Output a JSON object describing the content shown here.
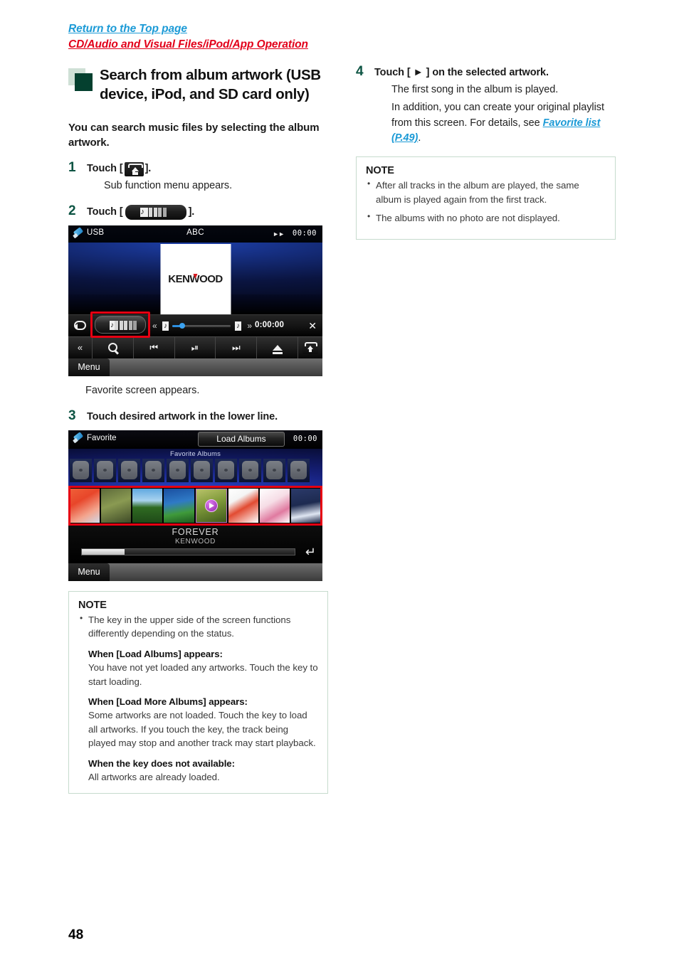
{
  "header": {
    "top_link": "Return to the Top page",
    "sub_link": "CD/Audio and Visual Files/iPod/App Operation"
  },
  "chapter": {
    "title": "Search from album artwork (USB device, iPod, and SD card only)",
    "lead": "You can search music files by selecting the album artwork."
  },
  "steps": {
    "s1": {
      "num": "1",
      "head_pre": "Touch [",
      "head_post": "].",
      "body": "Sub function menu appears."
    },
    "s2": {
      "num": "2",
      "head_pre": "Touch [",
      "head_post": "].",
      "body": "Favorite screen appears."
    },
    "s3": {
      "num": "3",
      "head": "Touch desired artwork in the lower line."
    },
    "s4": {
      "num": "4",
      "head": "Touch [ ► ] on the selected artwork.",
      "body1": "The first song in the album is played.",
      "body2_pre": "In addition, you can create your original playlist from this screen. For details, see ",
      "body2_link": "Favorite list (P.49)",
      "body2_post": "."
    }
  },
  "device_usb": {
    "source_label": "USB",
    "title": "ABC",
    "clock": "00:00",
    "artwork_logo": "KENWOOD",
    "elapsed_time": "0:00:00",
    "menu_label": "Menu"
  },
  "device_favorite": {
    "source_label": "Favorite",
    "load_button": "Load Albums",
    "clock": "00:00",
    "upper_caption": "Favorite Albums",
    "upper_placeholder_count": 10,
    "album_title": "FOREVER",
    "album_artist": "KENWOOD",
    "menu_label": "Menu",
    "thumbnails": [
      {
        "id": "album-1",
        "playing": false
      },
      {
        "id": "album-2",
        "playing": false
      },
      {
        "id": "album-3",
        "playing": false
      },
      {
        "id": "album-4",
        "playing": false
      },
      {
        "id": "album-5",
        "playing": true
      },
      {
        "id": "album-6",
        "playing": false
      },
      {
        "id": "album-7",
        "playing": false
      },
      {
        "id": "album-8",
        "playing": false
      }
    ]
  },
  "note_left": {
    "title": "NOTE",
    "bullet1": "The key in the upper side of the screen functions differently depending on the status.",
    "sub1_head": "When [Load Albums] appears:",
    "sub1_body": "You have not yet loaded any artworks. Touch the key to start loading.",
    "sub2_head": "When [Load More Albums] appears:",
    "sub2_body": "Some artworks are not loaded. Touch the key to load all artworks. If you touch the key, the track being played may stop and another track may start playback.",
    "sub3_head": "When the key does not available:",
    "sub3_body": "All artworks are already loaded."
  },
  "note_right": {
    "title": "NOTE",
    "bullet1": "After all tracks in the album are played, the same album is played again from the first track.",
    "bullet2": "The albums with no photo are not displayed."
  },
  "footer": {
    "page_number": "48"
  },
  "colors": {
    "link_blue": "#1b9ad6",
    "link_red": "#e2001a",
    "step_green": "#0d5443",
    "mark_green": "#04402f",
    "highlight_red": "#e60012"
  }
}
